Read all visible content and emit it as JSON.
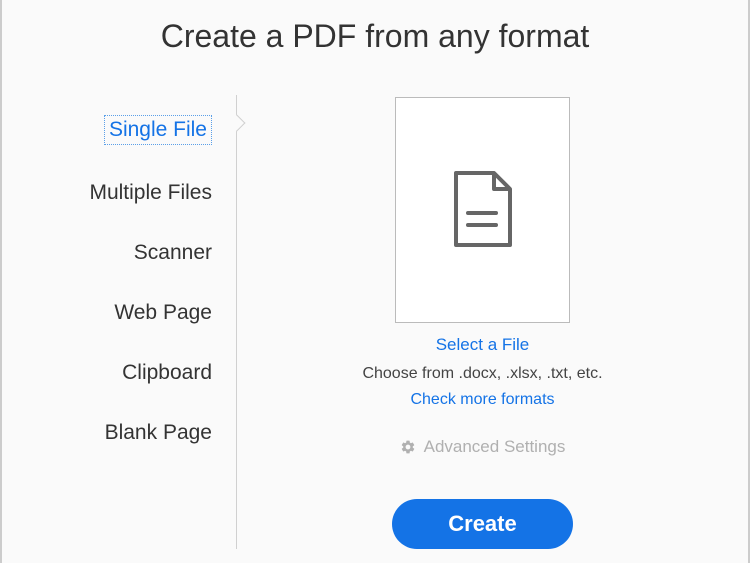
{
  "title": "Create a PDF from any format",
  "sidebar": {
    "items": [
      {
        "label": "Single File",
        "active": true
      },
      {
        "label": "Multiple Files",
        "active": false
      },
      {
        "label": "Scanner",
        "active": false
      },
      {
        "label": "Web Page",
        "active": false
      },
      {
        "label": "Clipboard",
        "active": false
      },
      {
        "label": "Blank Page",
        "active": false
      }
    ]
  },
  "main": {
    "select_file_label": "Select a File",
    "help_text": "Choose from .docx, .xlsx, .txt, etc.",
    "more_formats_label": "Check more formats",
    "advanced_label": "Advanced Settings",
    "create_button_label": "Create"
  }
}
